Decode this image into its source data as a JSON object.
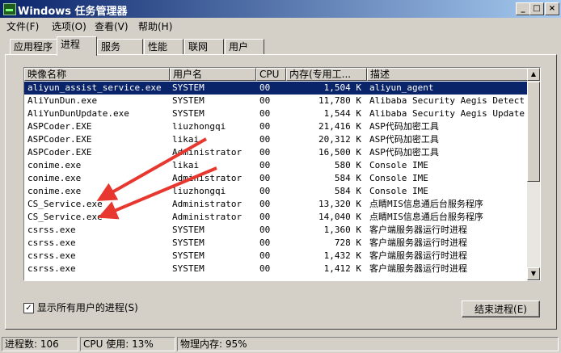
{
  "window": {
    "title": "Windows 任务管理器"
  },
  "menu": [
    "文件(F)",
    "选项(O)",
    "查看(V)",
    "帮助(H)"
  ],
  "tabs": [
    "应用程序",
    "进程",
    "服务",
    "性能",
    "联网",
    "用户"
  ],
  "active_tab": "进程",
  "columns": [
    "映像名称",
    "用户名",
    "CPU",
    "内存(专用工...",
    "描述"
  ],
  "processes": [
    {
      "name": "aliyun_assist_service.exe",
      "user": "SYSTEM",
      "cpu": "00",
      "mem": "1,504 K",
      "desc": "aliyun_agent"
    },
    {
      "name": "AliYunDun.exe",
      "user": "SYSTEM",
      "cpu": "00",
      "mem": "11,780 K",
      "desc": "Alibaba Security Aegis Detect Se"
    },
    {
      "name": "AliYunDunUpdate.exe",
      "user": "SYSTEM",
      "cpu": "00",
      "mem": "1,544 K",
      "desc": "Alibaba Security Aegis Update Se"
    },
    {
      "name": "ASPCoder.EXE",
      "user": "liuzhongqi",
      "cpu": "00",
      "mem": "21,416 K",
      "desc": "ASP代码加密工具"
    },
    {
      "name": "ASPCoder.EXE",
      "user": "likai",
      "cpu": "00",
      "mem": "20,312 K",
      "desc": "ASP代码加密工具"
    },
    {
      "name": "ASPCoder.EXE",
      "user": "Administrator",
      "cpu": "00",
      "mem": "16,500 K",
      "desc": "ASP代码加密工具"
    },
    {
      "name": "conime.exe",
      "user": "likai",
      "cpu": "00",
      "mem": "580 K",
      "desc": "Console IME"
    },
    {
      "name": "conime.exe",
      "user": "Administrator",
      "cpu": "00",
      "mem": "584 K",
      "desc": "Console IME"
    },
    {
      "name": "conime.exe",
      "user": "liuzhongqi",
      "cpu": "00",
      "mem": "584 K",
      "desc": "Console IME"
    },
    {
      "name": "CS_Service.exe",
      "user": "Administrator",
      "cpu": "00",
      "mem": "13,320 K",
      "desc": "点睛MIS信息通后台服务程序"
    },
    {
      "name": "CS_Service.exe",
      "user": "Administrator",
      "cpu": "00",
      "mem": "14,040 K",
      "desc": "点睛MIS信息通后台服务程序"
    },
    {
      "name": "csrss.exe",
      "user": "SYSTEM",
      "cpu": "00",
      "mem": "1,360 K",
      "desc": "客户端服务器运行时进程"
    },
    {
      "name": "csrss.exe",
      "user": "SYSTEM",
      "cpu": "00",
      "mem": "728 K",
      "desc": "客户端服务器运行时进程"
    },
    {
      "name": "csrss.exe",
      "user": "SYSTEM",
      "cpu": "00",
      "mem": "1,432 K",
      "desc": "客户端服务器运行时进程"
    },
    {
      "name": "csrss.exe",
      "user": "SYSTEM",
      "cpu": "00",
      "mem": "1,412 K",
      "desc": "客户端服务器运行时进程"
    }
  ],
  "selected_row": 0,
  "show_all_users": {
    "label": "显示所有用户的进程(S)",
    "checked": true
  },
  "end_process_button": "结束进程(E)",
  "status": {
    "process_count": "进程数: 106",
    "cpu_usage": "CPU 使用: 13%",
    "physical_memory": "物理内存: 95%"
  },
  "colors": {
    "titlebar": "#0a246a",
    "selection": "#0a246a",
    "annotation_arrow": "#e8372f"
  }
}
